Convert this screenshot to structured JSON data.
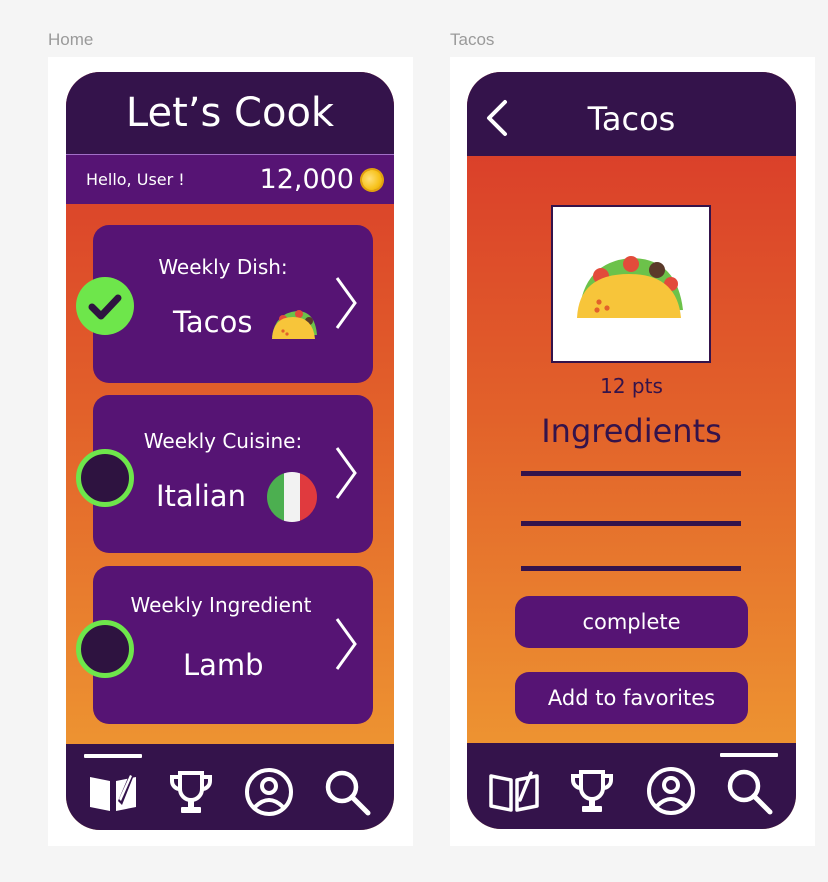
{
  "frames": {
    "home_label": "Home",
    "tacos_label": "Tacos"
  },
  "home": {
    "title": "Let’s Cook",
    "greeting": "Hello, User !",
    "coins": "12,000",
    "cards": [
      {
        "label": "Weekly Dish:",
        "value": "Tacos",
        "completed": true,
        "icon": "taco-emoji"
      },
      {
        "label": "Weekly Cuisine:",
        "value": "Italian",
        "completed": false,
        "icon": "italy-flag"
      },
      {
        "label": "Weekly Ingredient",
        "value": "Lamb",
        "completed": false
      }
    ],
    "nav": {
      "active": "recipes"
    }
  },
  "tacos": {
    "title": "Tacos",
    "points": "12 pts",
    "ingredients_title": "Ingredients",
    "ingredient_lines": 3,
    "complete_label": "complete",
    "favorites_label": "Add to favorites",
    "nav": {
      "active": "search"
    }
  },
  "nav_items": [
    "book-icon",
    "trophy-icon",
    "profile-icon",
    "search-icon"
  ],
  "colors": {
    "dark_purple": "#34134b",
    "purple": "#561474",
    "green": "#6ee64b",
    "gradient_top": "#d8362a",
    "gradient_bottom": "#f0a033"
  }
}
